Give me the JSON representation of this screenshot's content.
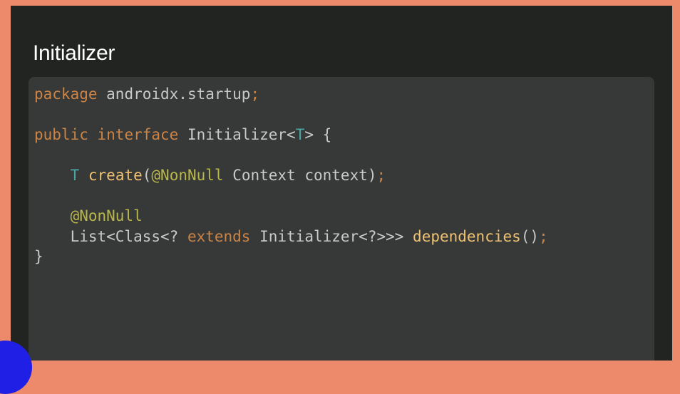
{
  "slide": {
    "title": "Initializer",
    "colors": {
      "border": "#ee8a6c",
      "slide_bg": "#222422",
      "code_bg": "#363937",
      "keyword": "#cc8446",
      "annotation": "#b9b64a",
      "type_param": "#4aa6a4",
      "method": "#f0c271",
      "text": "#c9c9c9",
      "blob": "#1f1fe6"
    }
  },
  "code": {
    "line1": {
      "kw_package": "package",
      "rest": " androidx.startup",
      "semi": ";"
    },
    "line3": {
      "kw_public": "public",
      "sp1": " ",
      "kw_interface": "interface",
      "name": " Initializer<",
      "T": "T",
      "close": "> {"
    },
    "line5": {
      "indent": "    ",
      "T": "T",
      "sp": " ",
      "create": "create",
      "paren": "(",
      "nonnull": "@NonNull",
      "params": " Context context)",
      "semi": ";"
    },
    "line7": {
      "indent": "    ",
      "nonnull": "@NonNull"
    },
    "line8": {
      "indent": "    ",
      "start": "List<Class<? ",
      "kw_extends": "extends",
      "mid": " Initializer<?>>> ",
      "deps": "dependencies",
      "end": "()",
      "semi": ";"
    },
    "line9": {
      "brace": "}"
    }
  }
}
